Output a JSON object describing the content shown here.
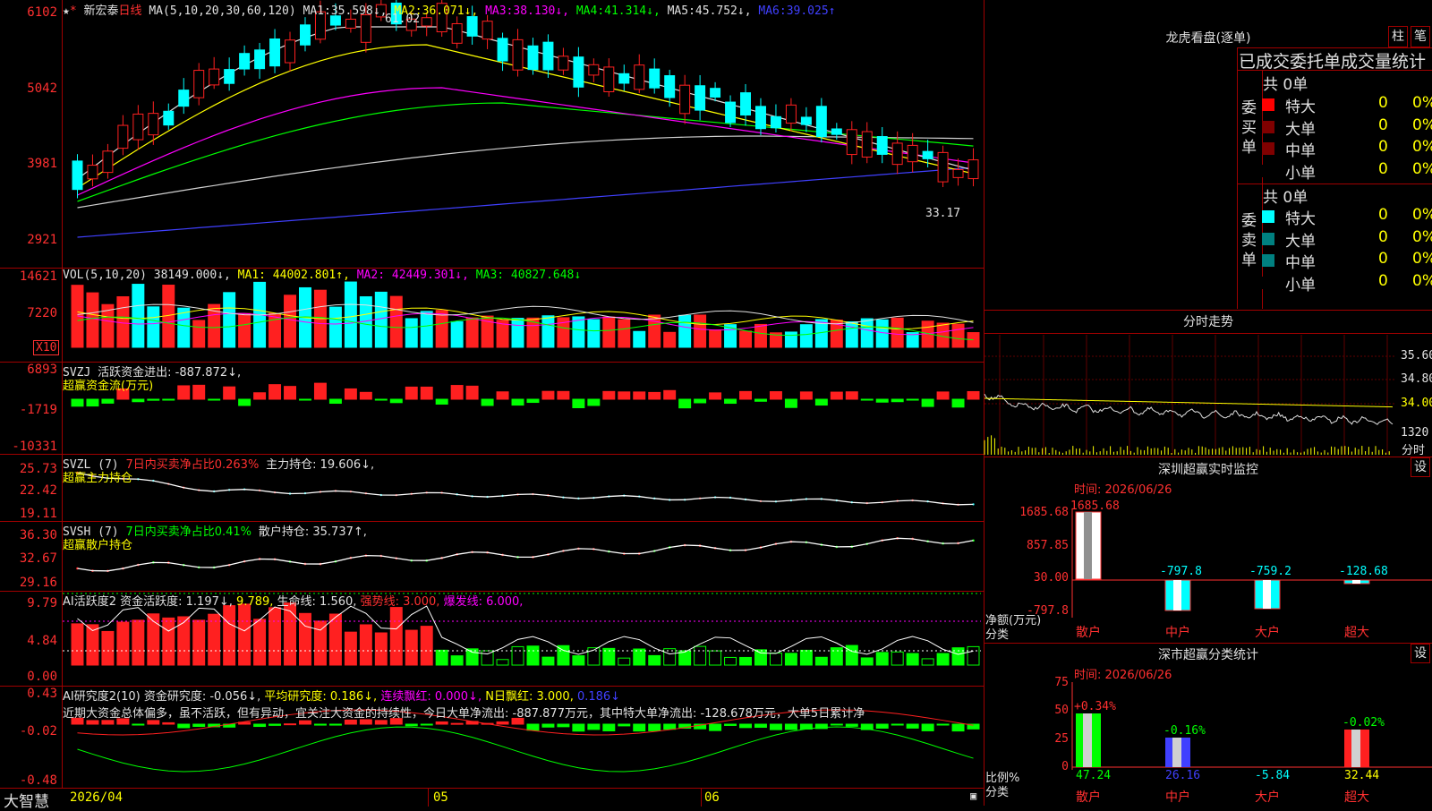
{
  "main": {
    "title_stock": "新宏泰",
    "title_period": "日线",
    "ma_header": "MA(5,10,20,30,60,120)",
    "ma": [
      {
        "label": "MA1:",
        "value": "35.598↓,",
        "color": "#e0e0e0"
      },
      {
        "label": "MA2:",
        "value": "36.071↓,",
        "color": "#ffff00"
      },
      {
        "label": "MA3:",
        "value": "38.130↓,",
        "color": "#ff00ff"
      },
      {
        "label": "MA4:",
        "value": "41.314↓,",
        "color": "#00ff00"
      },
      {
        "label": "MA5:",
        "value": "45.752↓,",
        "color": "#e0e0e0"
      },
      {
        "label": "MA6:",
        "value": "39.025↑",
        "color": "#4040ff"
      }
    ],
    "yaxis": [
      "6102",
      "5042",
      "3981",
      "2921"
    ],
    "high_label": "61.02",
    "low_label": "33.17"
  },
  "vol": {
    "header_name": "VOL(5,10,20)",
    "value": "38149.000↓,",
    "ma1": "MA1: 44002.801↑,",
    "ma2": "MA2: 42449.301↓,",
    "ma3": "MA3: 40827.648↓",
    "yaxis": [
      "14621",
      "7220"
    ],
    "unit": "X10"
  },
  "svzj": {
    "name": "SVZJ",
    "label": "活跃资金进出: -887.872↓,",
    "sub": "超赢资金流(万元)",
    "yaxis": [
      "6893",
      "-1719",
      "-10331"
    ]
  },
  "svzl": {
    "name": "SVZL (7)",
    "label1": "7日内买卖净占比0.263%",
    "label2": "主力持仓: 19.606↓,",
    "sub": "超赢主力持仓",
    "yaxis": [
      "25.73",
      "22.42",
      "19.11"
    ]
  },
  "svsh": {
    "name": "SVSH (7)",
    "label1": "7日内买卖净占比0.41%",
    "label2": "散户持仓: 35.737↑,",
    "sub": "超赢散户持仓",
    "yaxis": [
      "36.30",
      "32.67",
      "29.16"
    ]
  },
  "ai1": {
    "name": "AI活跃度2",
    "label1": "资金活跃度: 1.197↓,",
    "label2": "9.789,",
    "label3": "生命线: 1.560,",
    "label4": "强势线: 3.000,",
    "label5": "爆发线: 6.000,",
    "yaxis": [
      "9.79",
      "4.84",
      "0.00"
    ]
  },
  "ai2": {
    "name": "AI研究度2(10)",
    "label1": "资金研究度: -0.056↓,",
    "label2": "平均研究度: 0.186↓,",
    "label3": "连续飘红: 0.000↓,",
    "label4": "N日飘红: 3.000,",
    "label5": "0.186↓",
    "comment": "近期大资金总体偏多，虽不活跃，但有异动，宜关注大资金的持续性，今日大单净流出: -887.877万元，其中特大单净流出: -128.678万元，大单5日累计净",
    "yaxis": [
      "0.43",
      "-0.02",
      "-0.48"
    ]
  },
  "bottom": {
    "brand": "大智慧",
    "dates": [
      "2026/04",
      "05",
      "06"
    ]
  },
  "dragon": {
    "title": "龙虎看盘(逐单)",
    "btn1": "柱",
    "btn2": "笔",
    "subtitle": "已成交委托单成交量统计",
    "buy_label": "委买单",
    "sell_label": "委卖单",
    "buy_total": "共 0单",
    "sell_total": "共 0单",
    "buy_rows": [
      {
        "name": "特大",
        "value": "0",
        "pct": "0%",
        "color": "#ff0000"
      },
      {
        "name": "大单",
        "value": "0",
        "pct": "0%",
        "color": "#800000"
      },
      {
        "name": "中单",
        "value": "0",
        "pct": "0%",
        "color": "#800000"
      },
      {
        "name": "小单",
        "value": "0",
        "pct": "0%",
        "color": "#000000"
      }
    ],
    "sell_rows": [
      {
        "name": "特大",
        "value": "0",
        "pct": "0%",
        "color": "#00ffff"
      },
      {
        "name": "大单",
        "value": "0",
        "pct": "0%",
        "color": "#008080"
      },
      {
        "name": "中单",
        "value": "0",
        "pct": "0%",
        "color": "#008080"
      },
      {
        "name": "小单",
        "value": "0",
        "pct": "0%",
        "color": "#000000"
      }
    ]
  },
  "intraday": {
    "title": "分时走势",
    "yaxis": [
      "35.60",
      "34.80",
      "34.00"
    ],
    "vol_label": "1320",
    "bottom_label": "分时"
  },
  "sz_monitor": {
    "title": "深圳超赢实时监控",
    "btn": "设",
    "time": "时间: 2026/06/26",
    "yaxis": [
      "1685.68",
      "857.85",
      "30.00",
      "-797.8"
    ],
    "unit": "净额(万元)",
    "cat_label": "分类",
    "bar_values": [
      "1685.68",
      "-797.8",
      "-759.2",
      "-128.68"
    ],
    "categories": [
      "散户",
      "中户",
      "大户",
      "超大"
    ]
  },
  "sz_stat": {
    "title": "深市超赢分类统计",
    "btn": "设",
    "time": "时间: 2026/06/26",
    "yaxis": [
      "75",
      "50",
      "25",
      "0"
    ],
    "unit": "比例%",
    "cat_label": "分类",
    "top_values": [
      "+0.34%",
      "-0.16%",
      "",
      "-0.02%"
    ],
    "bottom_values": [
      "47.24",
      "26.16",
      "-5.84",
      "32.44"
    ],
    "categories": [
      "散户",
      "中户",
      "大户",
      "超大"
    ]
  }
}
